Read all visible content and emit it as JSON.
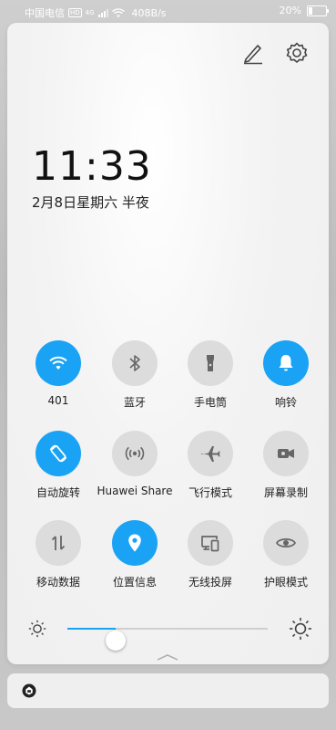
{
  "status_bar": {
    "carrier": "中国电信",
    "hd": "HD",
    "network": "4G",
    "speed": "408B/s",
    "battery_percent": "20%",
    "battery_level": 0.2
  },
  "header_icons": [
    "edit-icon",
    "settings-icon"
  ],
  "clock": {
    "time": "11:33",
    "date": "2月8日星期六 半夜"
  },
  "tiles": [
    {
      "label": "401",
      "icon": "wifi-icon",
      "on": true
    },
    {
      "label": "蓝牙",
      "icon": "bluetooth-icon",
      "on": false
    },
    {
      "label": "手电筒",
      "icon": "flashlight-icon",
      "on": false
    },
    {
      "label": "响铃",
      "icon": "bell-icon",
      "on": true
    },
    {
      "label": "自动旋转",
      "icon": "auto-rotate-icon",
      "on": true
    },
    {
      "label": "Huawei Share",
      "icon": "huawei-share-icon",
      "on": false
    },
    {
      "label": "飞行模式",
      "icon": "airplane-icon",
      "on": false
    },
    {
      "label": "屏幕录制",
      "icon": "screen-record-icon",
      "on": false
    },
    {
      "label": "移动数据",
      "icon": "mobile-data-icon",
      "on": false
    },
    {
      "label": "位置信息",
      "icon": "location-icon",
      "on": true
    },
    {
      "label": "无线投屏",
      "icon": "wireless-projection-icon",
      "on": false
    },
    {
      "label": "护眼模式",
      "icon": "eye-comfort-icon",
      "on": false
    }
  ],
  "brightness": {
    "level": 0.24
  },
  "colors": {
    "accent": "#1aa3f5",
    "tile_off": "#dcdcdc"
  },
  "notification": {
    "icon": "app-notification-icon"
  }
}
